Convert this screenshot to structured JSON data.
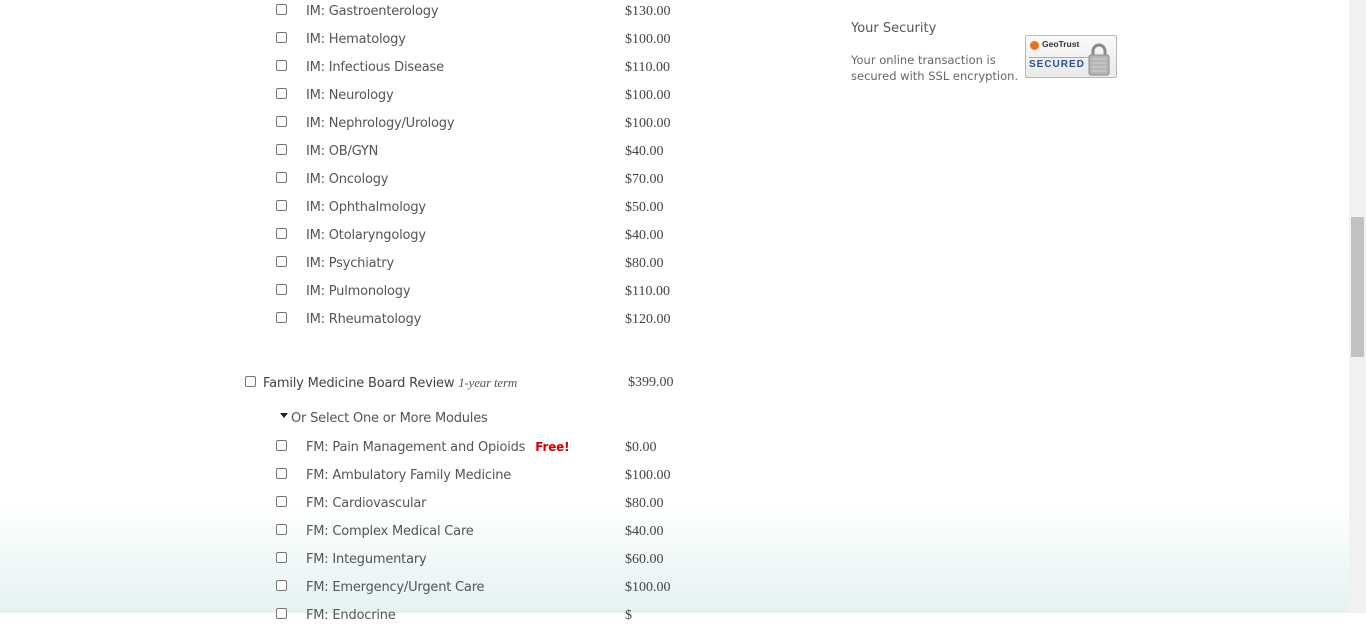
{
  "im_modules": [
    {
      "label": "IM: Gastroenterology",
      "price": "$130.00"
    },
    {
      "label": "IM: Hematology",
      "price": "$100.00"
    },
    {
      "label": "IM: Infectious Disease",
      "price": "$110.00"
    },
    {
      "label": "IM: Neurology",
      "price": "$100.00"
    },
    {
      "label": "IM: Nephrology/Urology",
      "price": "$100.00"
    },
    {
      "label": "IM: OB/GYN",
      "price": "$40.00"
    },
    {
      "label": "IM: Oncology",
      "price": "$70.00"
    },
    {
      "label": "IM: Ophthalmology",
      "price": "$50.00"
    },
    {
      "label": "IM: Otolaryngology",
      "price": "$40.00"
    },
    {
      "label": "IM: Psychiatry",
      "price": "$80.00"
    },
    {
      "label": "IM: Pulmonology",
      "price": "$110.00"
    },
    {
      "label": "IM: Rheumatology",
      "price": "$120.00"
    }
  ],
  "family_medicine": {
    "label": "Family Medicine Board Review",
    "term": "1-year term",
    "price": "$399.00",
    "modules_heading": "Or Select One or More Modules",
    "modules": [
      {
        "label": "FM: Pain Management and Opioids",
        "badge": "Free!",
        "price": "$0.00"
      },
      {
        "label": "FM: Ambulatory Family Medicine",
        "badge": "",
        "price": "$100.00"
      },
      {
        "label": "FM: Cardiovascular",
        "badge": "",
        "price": "$80.00"
      },
      {
        "label": "FM: Complex Medical Care",
        "badge": "",
        "price": "$40.00"
      },
      {
        "label": "FM: Integumentary",
        "badge": "",
        "price": "$60.00"
      },
      {
        "label": "FM: Emergency/Urgent Care",
        "badge": "",
        "price": "$100.00"
      },
      {
        "label": "FM: Endocrine",
        "badge": "",
        "price": "$"
      }
    ]
  },
  "security": {
    "title": "Your Security",
    "text": "Your online transaction is secured with SSL encryption.",
    "badge_brand": "GeoTrust",
    "badge_label": "SECURED"
  },
  "colors": {
    "free_badge": "#d60000",
    "page_gradient_bottom": "#e4f2f2"
  }
}
